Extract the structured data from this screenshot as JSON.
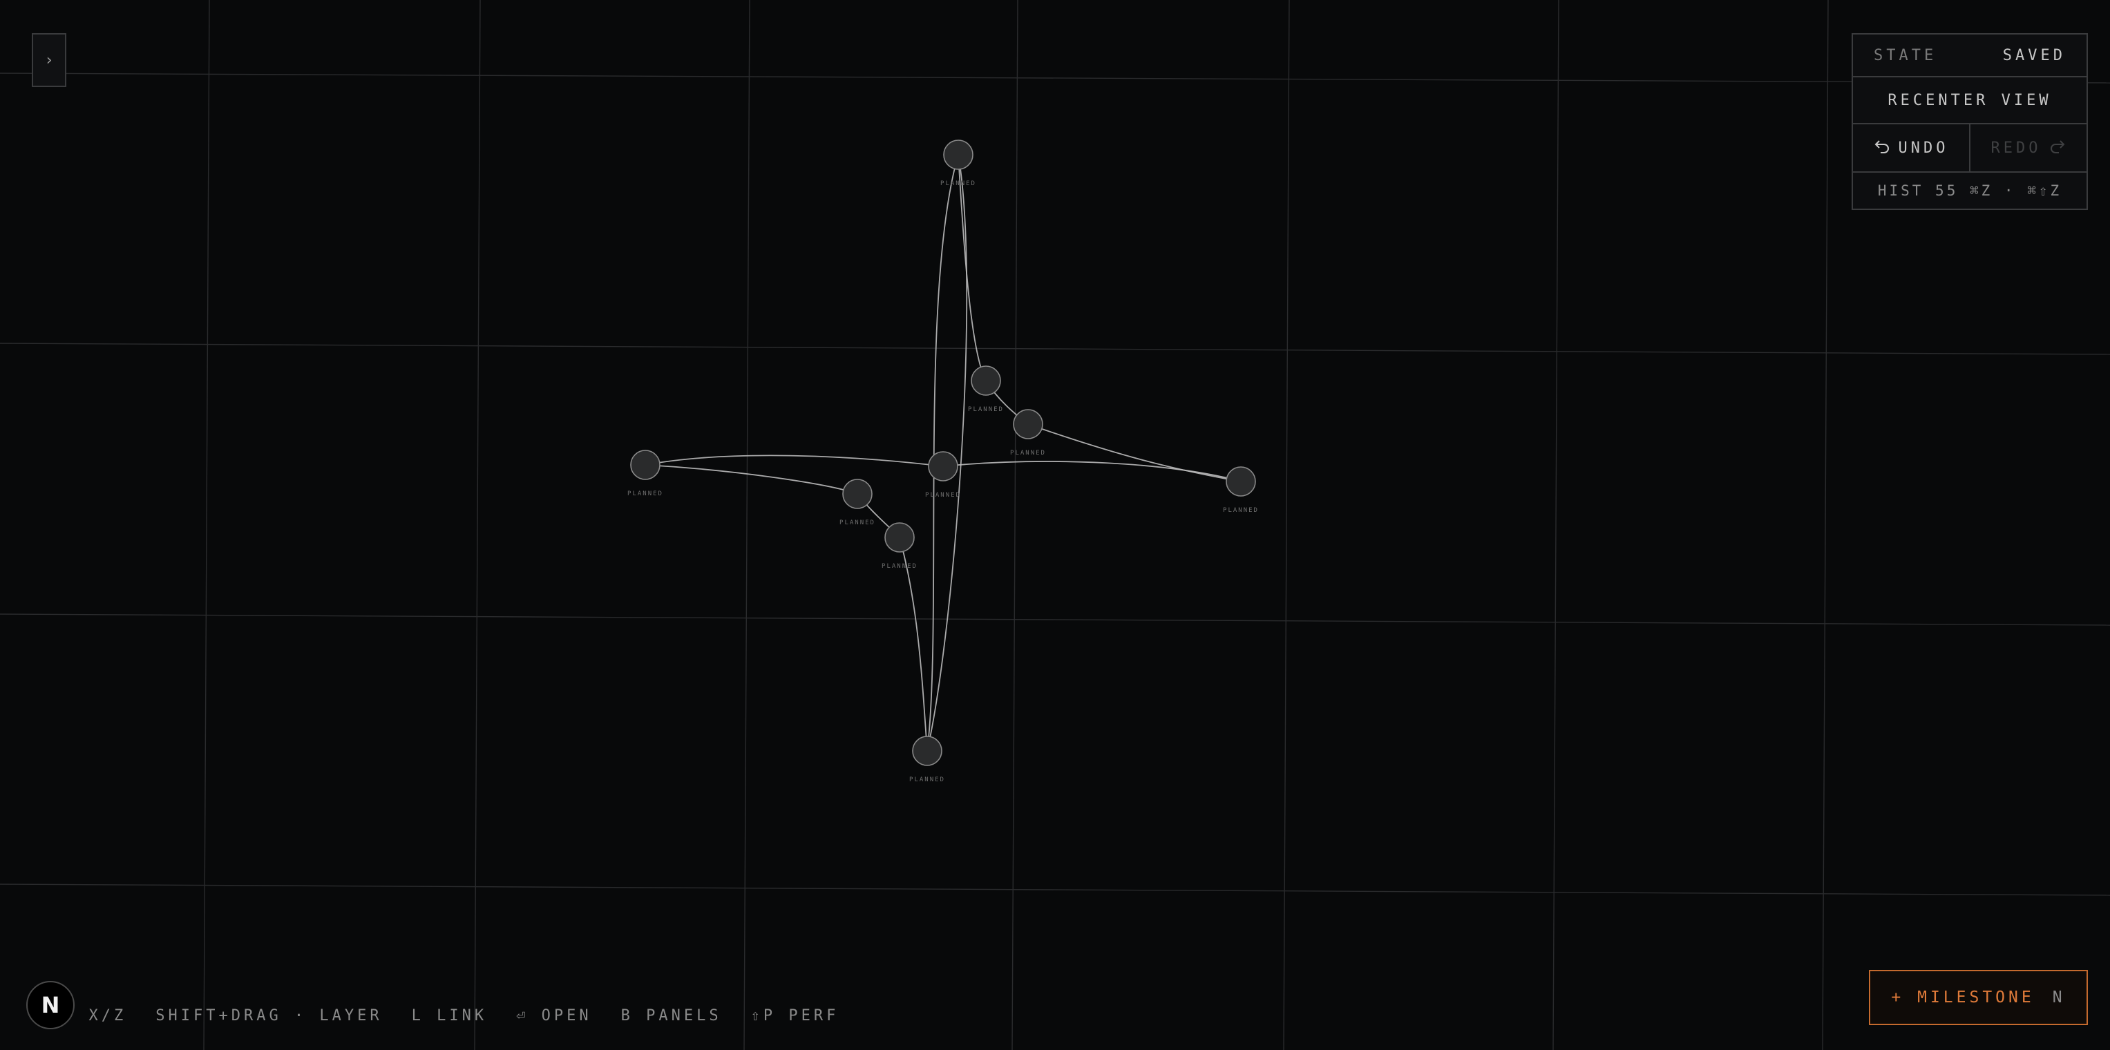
{
  "colors": {
    "background": "#08090a",
    "grid": "#2a2b2d",
    "accent": "#e07b3a",
    "node_fill": "#2a2b2c",
    "edge": "#bdbdbd"
  },
  "sidebar_toggle": {
    "icon": "chevron-right-icon",
    "label": "›"
  },
  "status_panel": {
    "state_label": "STATE",
    "state_value": "SAVED",
    "recenter_label": "RECENTER VIEW",
    "undo_label": "UNDO",
    "redo_label": "REDO",
    "history_text": "HIST 55 ⌘Z · ⌘⇧Z"
  },
  "shortcuts": [
    "· X/Z",
    "SHIFT+DRAG · LAYER",
    "L LINK",
    "⏎ OPEN",
    "B PANELS",
    "⇧P PERF"
  ],
  "logo": {
    "letter": "N"
  },
  "milestone_button": {
    "label": "+ MILESTONE",
    "key": "N"
  },
  "graph": {
    "nodes": [
      {
        "id": "n-top",
        "label": "PLANNED"
      },
      {
        "id": "n-upper-right-a",
        "label": "PLANNED"
      },
      {
        "id": "n-upper-right-b",
        "label": "PLANNED"
      },
      {
        "id": "n-left",
        "label": "PLANNED"
      },
      {
        "id": "n-center",
        "label": "PLANNED"
      },
      {
        "id": "n-right",
        "label": "PLANNED"
      },
      {
        "id": "n-lower-left-a",
        "label": "PLANNED"
      },
      {
        "id": "n-lower-left-b",
        "label": "PLANNED"
      },
      {
        "id": "n-bottom",
        "label": "PLANNED"
      }
    ],
    "edges": [
      [
        "n-top",
        "n-upper-right-a"
      ],
      [
        "n-upper-right-a",
        "n-upper-right-b"
      ],
      [
        "n-upper-right-b",
        "n-right"
      ],
      [
        "n-top",
        "n-bottom"
      ],
      [
        "n-left",
        "n-center"
      ],
      [
        "n-center",
        "n-right"
      ],
      [
        "n-left",
        "n-lower-left-a"
      ],
      [
        "n-lower-left-a",
        "n-lower-left-b"
      ],
      [
        "n-lower-left-b",
        "n-bottom"
      ]
    ]
  }
}
